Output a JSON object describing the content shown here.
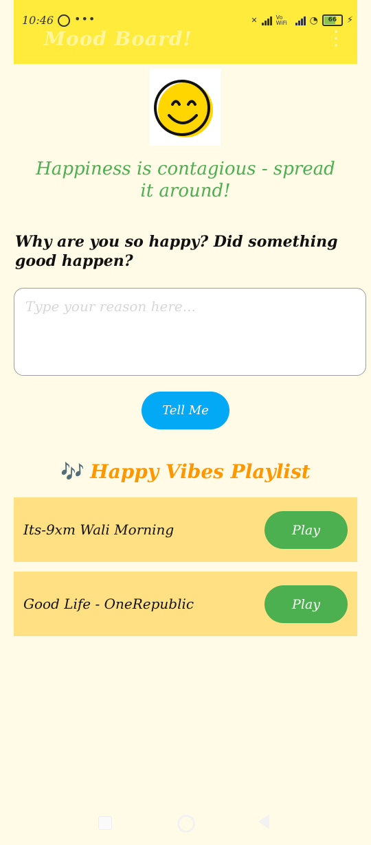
{
  "status_bar": {
    "time": "10:46",
    "dots": "•••",
    "vowifi": "Vo WiFi",
    "battery": "66"
  },
  "app_bar": {
    "title": "Mood Board!"
  },
  "logo": {
    "icon": "smiley-face-icon"
  },
  "tagline": "Happiness is contagious - spread it around!",
  "question": "Why are you so happy? Did something good happen?",
  "reason_input": {
    "placeholder": "Type your reason here...",
    "value": ""
  },
  "tell_button": {
    "label": "Tell Me"
  },
  "playlist": {
    "notes_icon": "🎶",
    "title": "Happy Vibes Playlist",
    "tracks": [
      {
        "name": "Its-9xm Wali Morning",
        "button": "Play"
      },
      {
        "name": "Good Life - OneRepublic",
        "button": "Play"
      }
    ]
  },
  "colors": {
    "background": "#FFFBE6",
    "app_bar": "#FFEB3B",
    "tagline": "#4CAF50",
    "tell_button": "#03A9F4",
    "playlist_title": "#FF9800",
    "track_card": "#FFE082",
    "play_button": "#4CAF50"
  }
}
